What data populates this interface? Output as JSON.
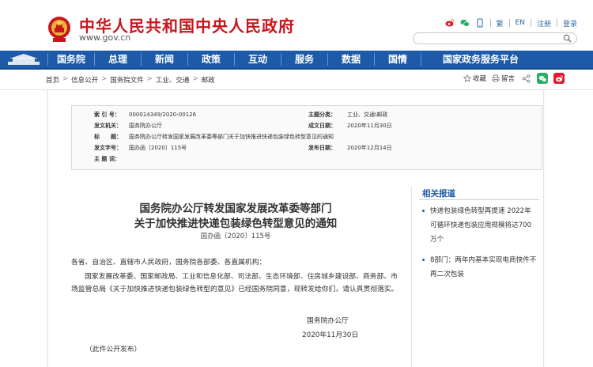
{
  "header": {
    "site_title": "中华人民共和国中央人民政府",
    "site_url": "www.gov.cn",
    "lang_trad": "繁",
    "lang_en": "EN",
    "register": "注册",
    "login": "登录",
    "search_placeholder": ""
  },
  "nav": {
    "items": [
      "国务院",
      "总理",
      "新闻",
      "政策",
      "互动",
      "服务",
      "数据",
      "国情",
      "国家政务服务平台"
    ]
  },
  "breadcrumb": {
    "items": [
      "首页",
      "信息公开",
      "国务院文件",
      "工业、交通",
      "邮政"
    ]
  },
  "actions": {
    "favorite": "收藏",
    "print": "留言"
  },
  "meta": {
    "index_label": "索 引 号：",
    "index_value": "000014349/2020-00126",
    "category_label": "主题分类：",
    "category_value": "工业、交通\\邮政",
    "issuer_label": "发文机关：",
    "issuer_value": "国务院办公厅",
    "written_label": "成文日期：",
    "written_value": "2020年11月30日",
    "title_label": "标　　题：",
    "title_value": "国务院办公厅转发国家发展改革委等部门关于加快推进快递包装绿色转型意见的通知",
    "docno_label": "发文字号：",
    "docno_value": "国办函〔2020〕115号",
    "published_label": "发布日期：",
    "published_value": "2020年12月14日",
    "keywords_label": "主 题 词：",
    "keywords_value": ""
  },
  "article": {
    "title_line1": "国务院办公厅转发国家发展改革委等部门",
    "title_line2": "关于加快推进快递包装绿色转型意见的通知",
    "doc_no": "国办函〔2020〕115号",
    "salutation": "各省、自治区、直辖市人民政府，国务院各部委、各直属机构：",
    "paragraph": "国家发展改革委、国家邮政局、工业和信息化部、司法部、生态环境部、住房城乡建设部、商务部、市场监管总局《关于加快推进快递包装绿色转型的意见》已经国务院同意，现转发给你们，请认真贯彻落实。",
    "signature_org": "国务院办公厅",
    "signature_date": "2020年11月30日",
    "footnote": "（此件公开发布）"
  },
  "sidebar": {
    "title": "相关报道",
    "items": [
      "快递包装绿色转型再提速 2022年可循环快递包装应用规模将达700万个",
      "8部门：两年内基本实现电商快件不再二次包装"
    ]
  },
  "colors": {
    "brand_red": "#c8161d",
    "nav_blue": "#1d5aa8"
  }
}
